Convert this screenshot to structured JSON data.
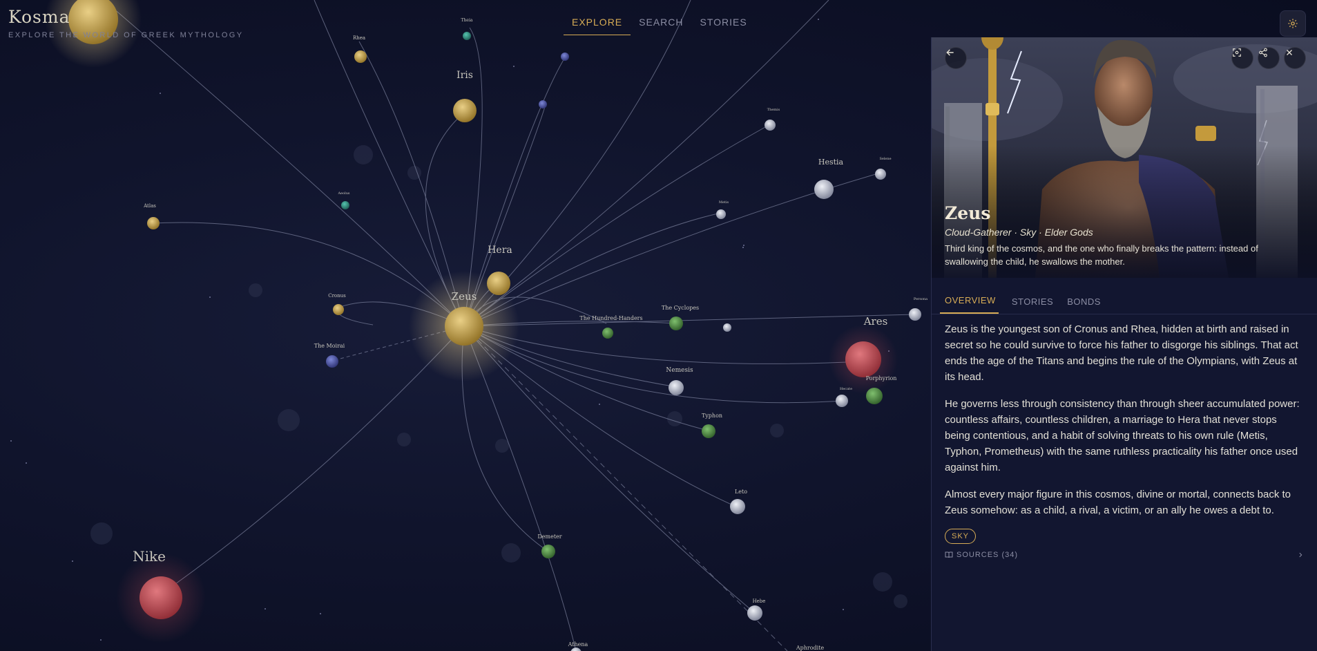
{
  "app": {
    "title": "Kosma",
    "subtitle": "EXPLORE THE WORLD OF GREEK MYTHOLOGY"
  },
  "nav": {
    "tabs": [
      "EXPLORE",
      "SEARCH",
      "STORIES"
    ],
    "active_tab": "EXPLORE"
  },
  "icons": {
    "settings": "gear-icon",
    "back": "arrow-left-icon",
    "focus": "focus-icon",
    "share": "share-icon",
    "close": "close-icon",
    "sources": "book-icon",
    "chevron": "chevron-right-icon"
  },
  "colors": {
    "accent": "#d8ad56",
    "background": "#0b0f24",
    "panel": "#121630",
    "node_gold": "#c9a34a",
    "node_red": "#c4474f",
    "node_green": "#4f8f45",
    "node_silver": "#b8bccb"
  },
  "graph": {
    "center_node": "Zeus",
    "nodes": [
      "Zeus",
      "Hera",
      "Iris",
      "Rhea",
      "Theia",
      "Hestia",
      "Atlas",
      "Cronus",
      "The Moirai",
      "The Hundred-Handers",
      "The Cyclopes",
      "Ares",
      "Porphyrion",
      "Nemesis",
      "Typhon",
      "Leto",
      "Demeter",
      "Hebe",
      "Athena",
      "Aphrodite",
      "Nike",
      "Persona",
      "Themis",
      "Selene",
      "Aeolus",
      "Hecate",
      "Metis"
    ]
  },
  "panel": {
    "deity": {
      "name": "Zeus",
      "epithet": "Cloud-Gatherer · Sky · Elder Gods",
      "description": "Third king of the cosmos, and the one who finally breaks the pattern: instead of swallowing the child, he swallows the mother."
    },
    "tabs": [
      "OVERVIEW",
      "STORIES",
      "BONDS"
    ],
    "active_tab": "OVERVIEW",
    "paragraphs": [
      "Zeus is the youngest son of Cronus and Rhea, hidden at birth and raised in secret so he could survive to force his father to disgorge his siblings. That act ends the age of the Titans and begins the rule of the Olympians, with Zeus at its head.",
      "He governs less through consistency than through sheer accumulated power: countless affairs, countless children, a marriage to Hera that never stops being contentious, and a habit of solving threats to his own rule (Metis, Typhon, Prometheus) with the same ruthless practicality his father once used against him.",
      "Almost every major figure in this cosmos, divine or mortal, connects back to Zeus somehow: as a child, a rival, a victim, or an ally he owes a debt to."
    ],
    "tag": "SKY",
    "sources_label": "SOURCES (34)"
  }
}
